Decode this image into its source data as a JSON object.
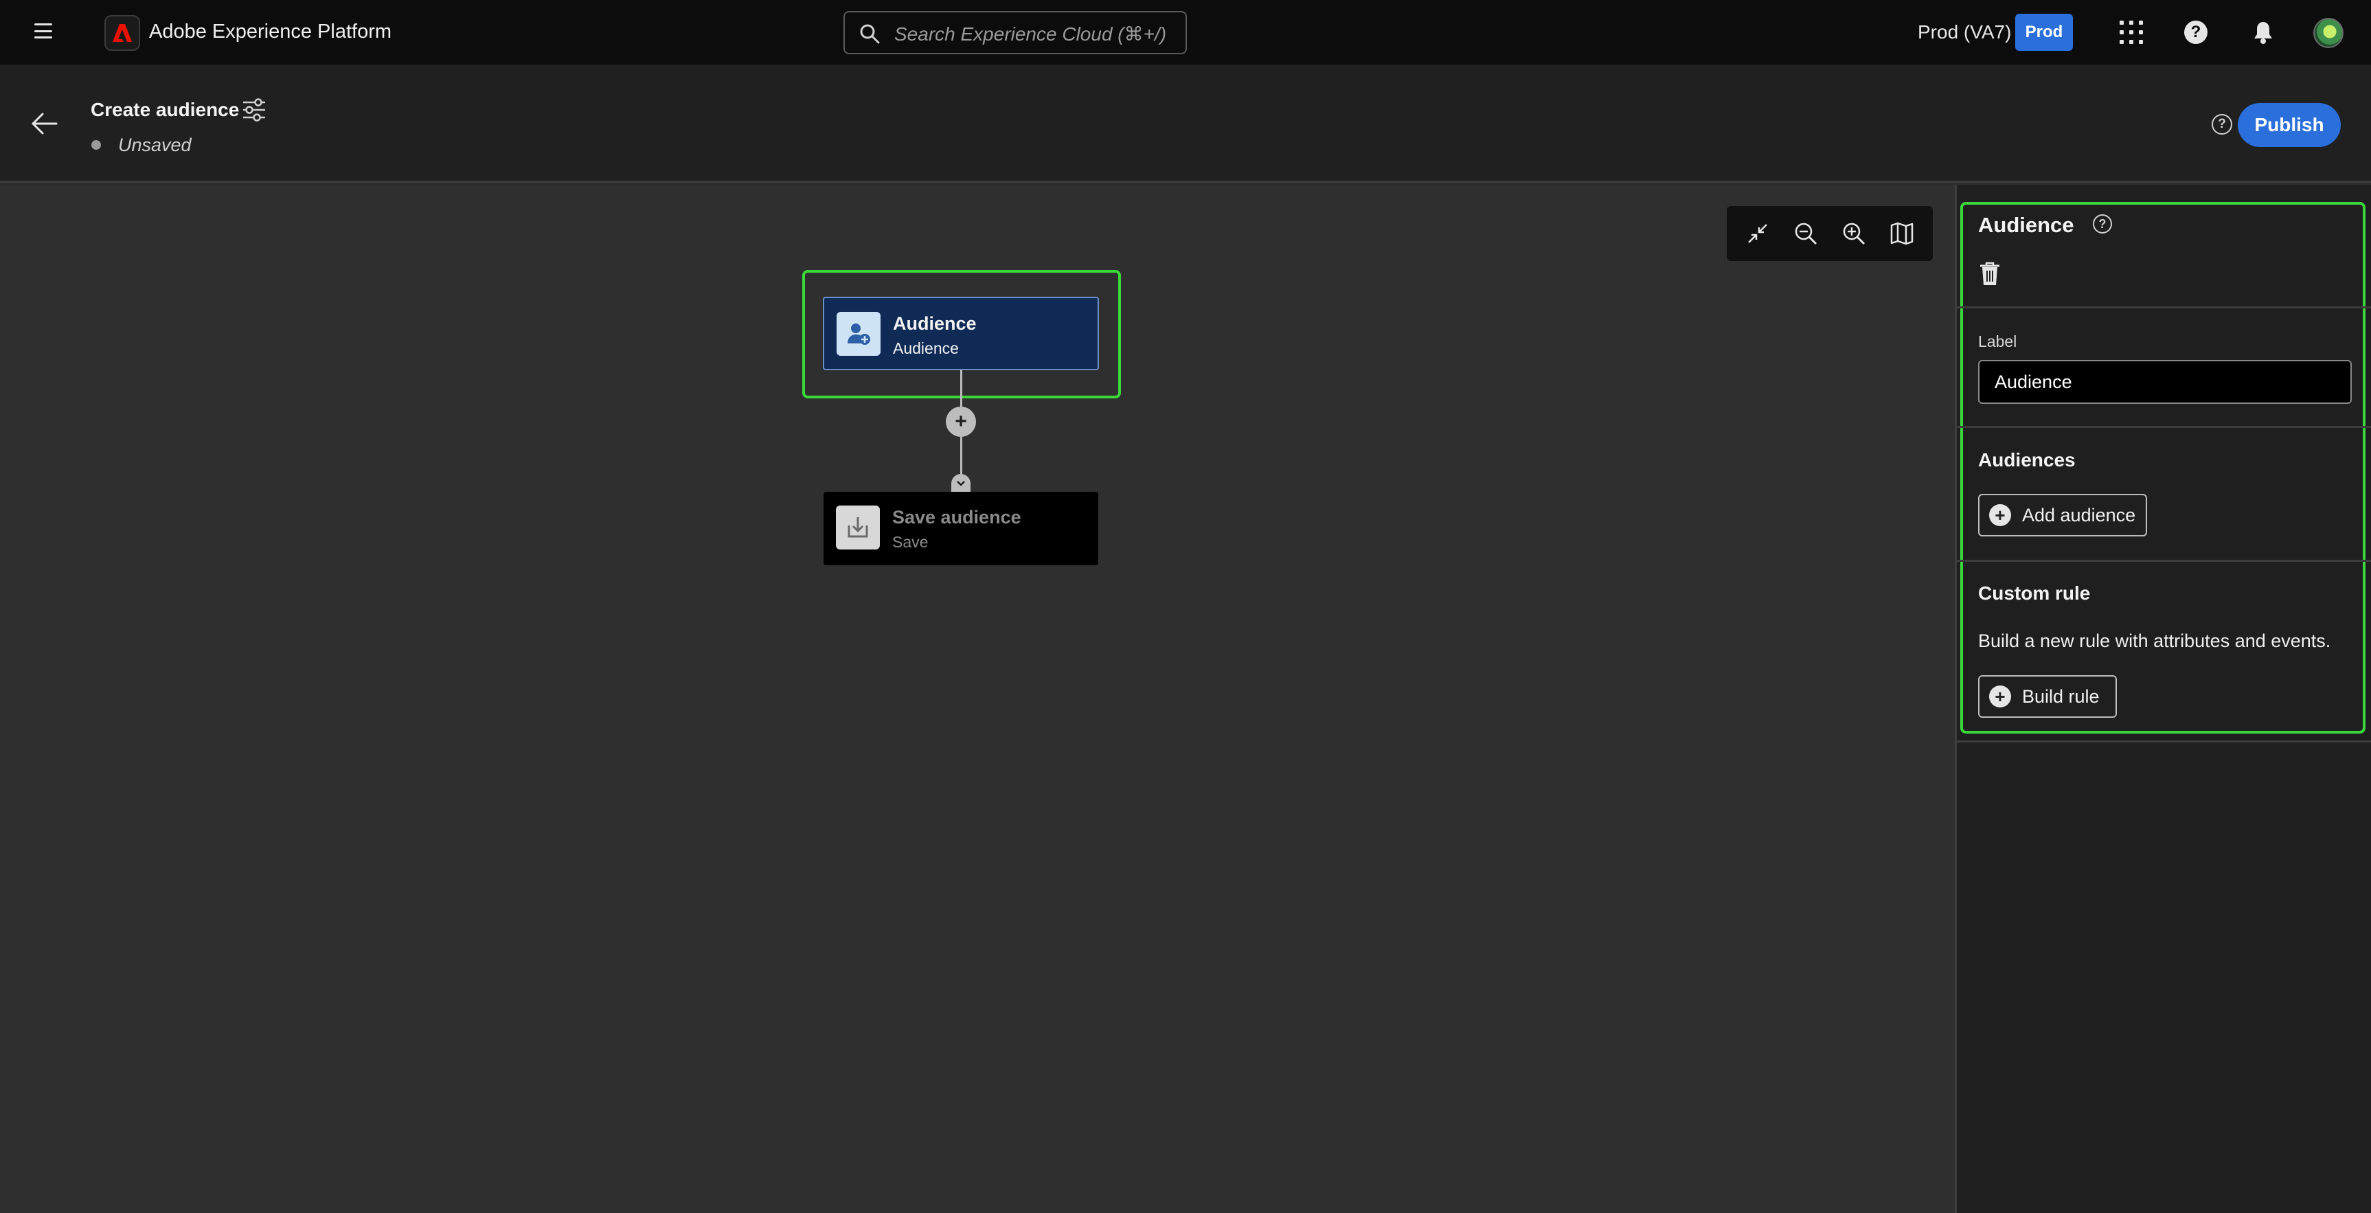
{
  "header": {
    "app_title": "Adobe Experience Platform",
    "search_placeholder": "Search Experience Cloud (⌘+/)",
    "sandbox_label": "Prod (VA7)",
    "sandbox_badge": "Prod",
    "help_glyph": "?"
  },
  "subheader": {
    "title": "Create audience",
    "status": "Unsaved",
    "publish_label": "Publish",
    "help_glyph": "?"
  },
  "canvas": {
    "add_glyph": "+",
    "nodes": [
      {
        "title": "Audience",
        "subtitle": "Audience",
        "icon": "audience-add-icon"
      },
      {
        "title": "Save audience",
        "subtitle": "Save",
        "icon": "save-download-icon"
      }
    ],
    "toolbar": [
      "collapse-icon",
      "zoom-out-icon",
      "zoom-in-icon",
      "map-icon"
    ]
  },
  "panel": {
    "title": "Audience",
    "help_glyph": "?",
    "label_caption": "Label",
    "label_value": "Audience",
    "audiences_heading": "Audiences",
    "add_audience_label": "Add audience",
    "custom_rule_heading": "Custom rule",
    "custom_rule_desc": "Build a new rule with attributes and events.",
    "build_rule_label": "Build rule",
    "plus_glyph": "+"
  },
  "colors": {
    "accent": "#2a6fdb",
    "highlight": "#3bd83b",
    "node_bg": "#0e2a55"
  }
}
